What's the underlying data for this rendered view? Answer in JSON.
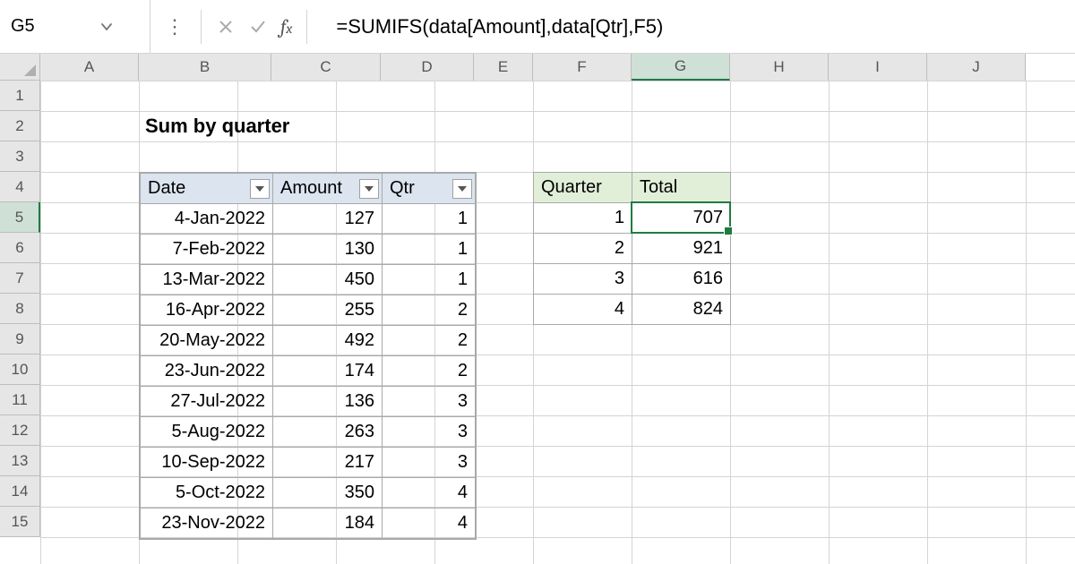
{
  "formula_bar": {
    "name_box": "G5",
    "formula": "=SUMIFS(data[Amount],data[Qtr],F5)"
  },
  "columns": [
    "A",
    "B",
    "C",
    "D",
    "E",
    "F",
    "G",
    "H",
    "I",
    "J"
  ],
  "rows": [
    "1",
    "2",
    "3",
    "4",
    "5",
    "6",
    "7",
    "8",
    "9",
    "10",
    "11",
    "12",
    "13",
    "14",
    "15"
  ],
  "selected_col": "G",
  "selected_row": "5",
  "title": "Sum by quarter",
  "data_table": {
    "headers": [
      "Date",
      "Amount",
      "Qtr"
    ],
    "rows": [
      {
        "date": "4-Jan-2022",
        "amount": "127",
        "qtr": "1"
      },
      {
        "date": "7-Feb-2022",
        "amount": "130",
        "qtr": "1"
      },
      {
        "date": "13-Mar-2022",
        "amount": "450",
        "qtr": "1"
      },
      {
        "date": "16-Apr-2022",
        "amount": "255",
        "qtr": "2"
      },
      {
        "date": "20-May-2022",
        "amount": "492",
        "qtr": "2"
      },
      {
        "date": "23-Jun-2022",
        "amount": "174",
        "qtr": "2"
      },
      {
        "date": "27-Jul-2022",
        "amount": "136",
        "qtr": "3"
      },
      {
        "date": "5-Aug-2022",
        "amount": "263",
        "qtr": "3"
      },
      {
        "date": "10-Sep-2022",
        "amount": "217",
        "qtr": "3"
      },
      {
        "date": "5-Oct-2022",
        "amount": "350",
        "qtr": "4"
      },
      {
        "date": "23-Nov-2022",
        "amount": "184",
        "qtr": "4"
      }
    ]
  },
  "summary_table": {
    "headers": [
      "Quarter",
      "Total"
    ],
    "rows": [
      {
        "quarter": "1",
        "total": "707"
      },
      {
        "quarter": "2",
        "total": "921"
      },
      {
        "quarter": "3",
        "total": "616"
      },
      {
        "quarter": "4",
        "total": "824"
      }
    ]
  }
}
